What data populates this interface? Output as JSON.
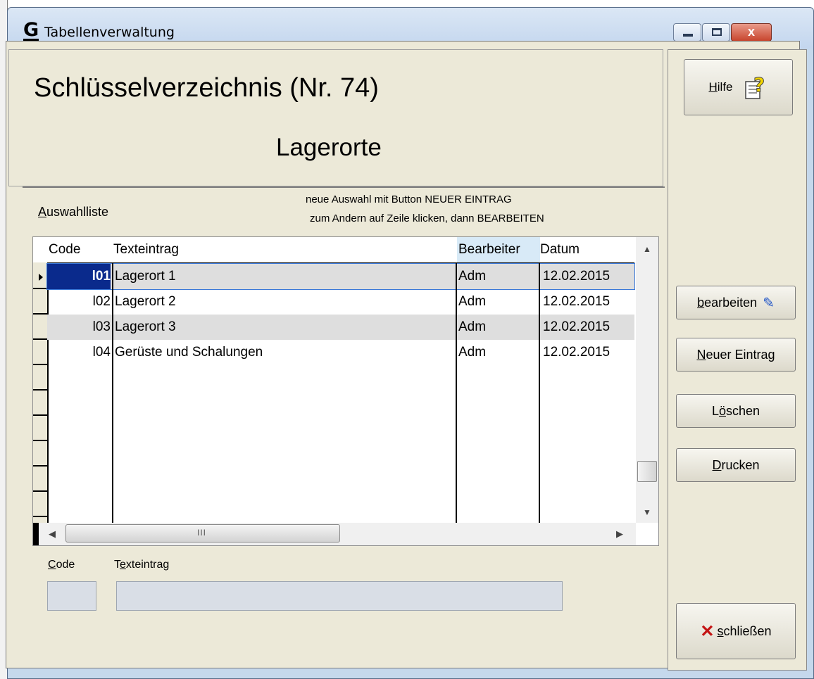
{
  "window": {
    "title": "Tabellenverwaltung",
    "app_icon": "G",
    "close_glyph": "x"
  },
  "header": {
    "title": "Schlüsselverzeichnis (Nr. 74)",
    "subtitle": "Lagerorte"
  },
  "list": {
    "label_accel": "A",
    "label_rest": "uswahlliste",
    "hint_line1": "neue Auswahl mit Button NEUER EINTRAG",
    "hint_line2": "zum Andern auf Zeile klicken, dann BEARBEITEN",
    "columns": [
      "Code",
      "Texteintrag",
      "Bearbeiter",
      "Datum"
    ],
    "rows": [
      {
        "code": "l01",
        "text": "Lagerort 1",
        "user": "Adm",
        "date": "12.02.2015"
      },
      {
        "code": "l02",
        "text": "Lagerort 2",
        "user": "Adm",
        "date": "12.02.2015"
      },
      {
        "code": "l03",
        "text": "Lagerort 3",
        "user": "Adm",
        "date": "12.02.2015"
      },
      {
        "code": "l04",
        "text": "Gerüste und Schalungen",
        "user": "Adm",
        "date": "12.02.2015"
      }
    ],
    "selected_row": 0,
    "hscroll_grip": "III"
  },
  "fields": {
    "code_label_accel": "C",
    "code_label_rest": "ode",
    "text_label_pre": "T",
    "text_label_accel": "e",
    "text_label_rest": "xteintrag",
    "code_value": "",
    "text_value": ""
  },
  "buttons": {
    "help_accel": "H",
    "help_rest": "ilfe",
    "edit_accel": "b",
    "edit_rest": "earbeiten",
    "new_accel": "N",
    "new_rest": "euer Eintrag",
    "delete_pre": "L",
    "delete_accel": "ö",
    "delete_rest": "schen",
    "print_accel": "D",
    "print_rest": "rucken",
    "close_accel": "s",
    "close_rest": "chließen"
  },
  "icons": {
    "help": "help-document-icon",
    "edit": "edit-icon",
    "close": "close-x-icon"
  },
  "colors": {
    "selected_code_bg": "#0a2a8c",
    "header_bearbeiter_bg": "#d8eaf7",
    "panel_bg": "#ece9d8",
    "close_x": "#c41414"
  }
}
